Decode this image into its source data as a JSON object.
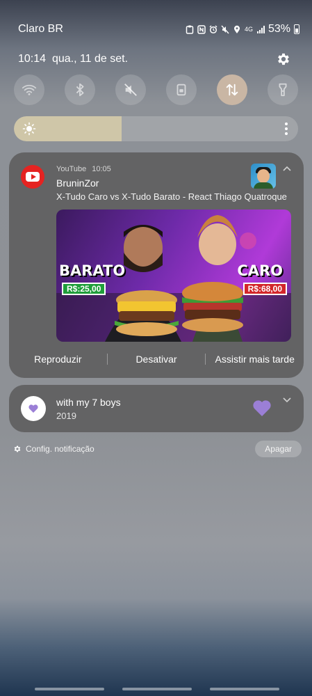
{
  "status_bar": {
    "carrier": "Claro BR",
    "network": "4G",
    "battery": "53%",
    "icons": [
      "clipboard-icon",
      "nfc-icon",
      "alarm-icon",
      "mute-icon",
      "location-icon",
      "signal-icon",
      "battery-icon"
    ]
  },
  "quick_panel": {
    "time": "10:14",
    "date": "qua., 11 de set.",
    "tiles": [
      {
        "name": "wifi",
        "icon": "wifi-icon",
        "active": false
      },
      {
        "name": "bluetooth",
        "icon": "bluetooth-icon",
        "active": false
      },
      {
        "name": "sound",
        "icon": "mute-icon",
        "active": false
      },
      {
        "name": "rotation",
        "icon": "rotation-lock-icon",
        "active": false
      },
      {
        "name": "mobile-data",
        "icon": "data-arrows-icon",
        "active": true
      },
      {
        "name": "flashlight",
        "icon": "flashlight-icon",
        "active": false
      }
    ],
    "brightness_level": 0.38
  },
  "notifications": {
    "youtube": {
      "app": "YouTube",
      "time": "10:05",
      "title": "BruninZor",
      "text": "X-Tudo Caro vs X-Tudo Barato - React Thiago Quatroque",
      "thumbnail": {
        "label_left": "BARATO",
        "price_left": "R$:25,00",
        "label_right": "CARO",
        "price_right": "R$:68,00"
      },
      "actions": [
        "Reproduzir",
        "Desativar",
        "Assistir mais tarde"
      ]
    },
    "music": {
      "title": "with my 7 boys",
      "subtitle": "2019",
      "accent": "#9b7fd6"
    }
  },
  "footer": {
    "settings_label": "Config. notificação",
    "clear_label": "Apagar"
  }
}
